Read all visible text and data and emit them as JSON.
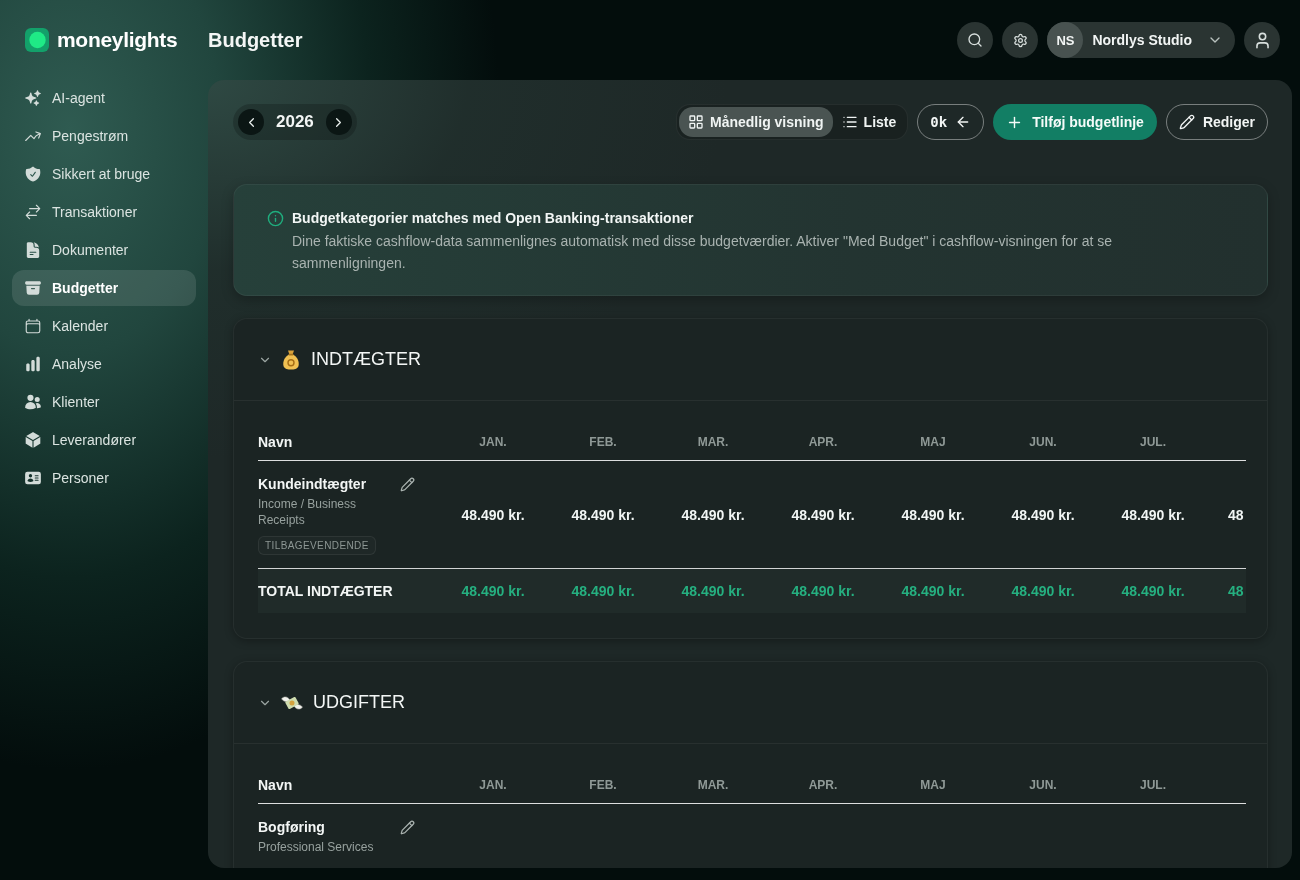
{
  "sidebar": {
    "logo": "moneylights",
    "items": [
      {
        "label": "AI-agent",
        "selected": false
      },
      {
        "label": "Pengestrøm",
        "selected": false
      },
      {
        "label": "Sikkert at bruge",
        "selected": false
      },
      {
        "label": "Transaktioner",
        "selected": false
      },
      {
        "label": "Dokumenter",
        "selected": false
      },
      {
        "label": "Budgetter",
        "selected": true
      },
      {
        "label": "Kalender",
        "selected": false
      },
      {
        "label": "Analyse",
        "selected": false
      },
      {
        "label": "Klienter",
        "selected": false
      },
      {
        "label": "Leverandører",
        "selected": false
      },
      {
        "label": "Personer",
        "selected": false
      }
    ]
  },
  "header": {
    "title": "Budgetter",
    "account": {
      "initials": "NS",
      "name": "Nordlys Studio"
    }
  },
  "toolbar": {
    "year": "2026",
    "view_options": [
      {
        "label": "Månedlig visning",
        "selected": true
      },
      {
        "label": "Liste",
        "selected": false
      }
    ],
    "scale_button": "0k",
    "add_button": "Tilføj budgetlinje",
    "edit_button": "Rediger"
  },
  "info_banner": {
    "title": "Budgetkategorier matches med Open Banking-transaktioner",
    "text": "Dine faktiske cashflow-data sammenlignes automatisk med disse budgetværdier. Aktiver \"Med Budget\" i cashflow-visningen for at se sammenligningen."
  },
  "sections": [
    {
      "title": "INDTÆGTER",
      "expanded": true,
      "columns": [
        "Navn",
        "JAN.",
        "FEB.",
        "MAR.",
        "APR.",
        "MAJ",
        "JUN.",
        "JUL."
      ],
      "rows": [
        {
          "name": "Kundeindtægter",
          "category": "Income / Business Receipts",
          "badge": "TILBAGEVENDENDE",
          "values": [
            "48.490 kr.",
            "48.490 kr.",
            "48.490 kr.",
            "48.490 kr.",
            "48.490 kr.",
            "48.490 kr.",
            "48.490 kr.",
            "48"
          ]
        }
      ],
      "total": {
        "label": "TOTAL INDTÆGTER",
        "values": [
          "48.490 kr.",
          "48.490 kr.",
          "48.490 kr.",
          "48.490 kr.",
          "48.490 kr.",
          "48.490 kr.",
          "48.490 kr.",
          "48"
        ]
      }
    },
    {
      "title": "UDGIFTER",
      "expanded": true,
      "columns": [
        "Navn",
        "JAN.",
        "FEB.",
        "MAR.",
        "APR.",
        "MAJ",
        "JUN.",
        "JUL."
      ],
      "rows": [
        {
          "name": "Bogføring",
          "category": "Professional Services"
        }
      ]
    }
  ]
}
